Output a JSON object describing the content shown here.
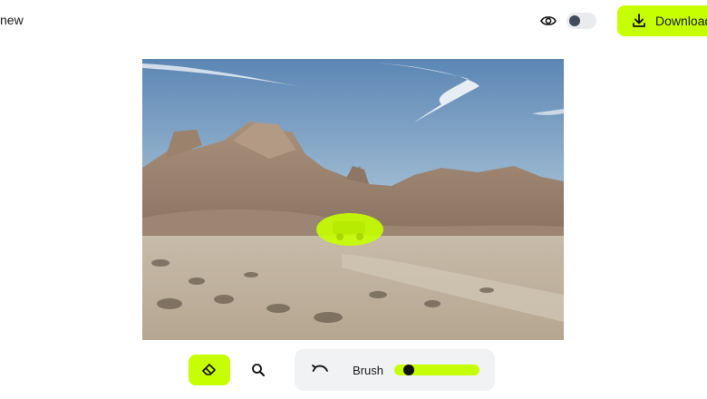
{
  "header": {
    "title": "new",
    "download_label": "Download",
    "view_icon": "eye-icon",
    "toggle_on": false
  },
  "canvas": {
    "subject": "desert rock formation photograph with highlighted vehicle mask"
  },
  "toolbar": {
    "eraser_icon": "eraser-icon",
    "zoom_icon": "magnifier-icon",
    "undo_icon": "undo-icon",
    "brush_label": "Brush",
    "brush_size_fraction": 0.12
  },
  "colors": {
    "accent": "#c6ff00",
    "knob": "#3f4a5a",
    "panel": "#f1f2f4"
  }
}
